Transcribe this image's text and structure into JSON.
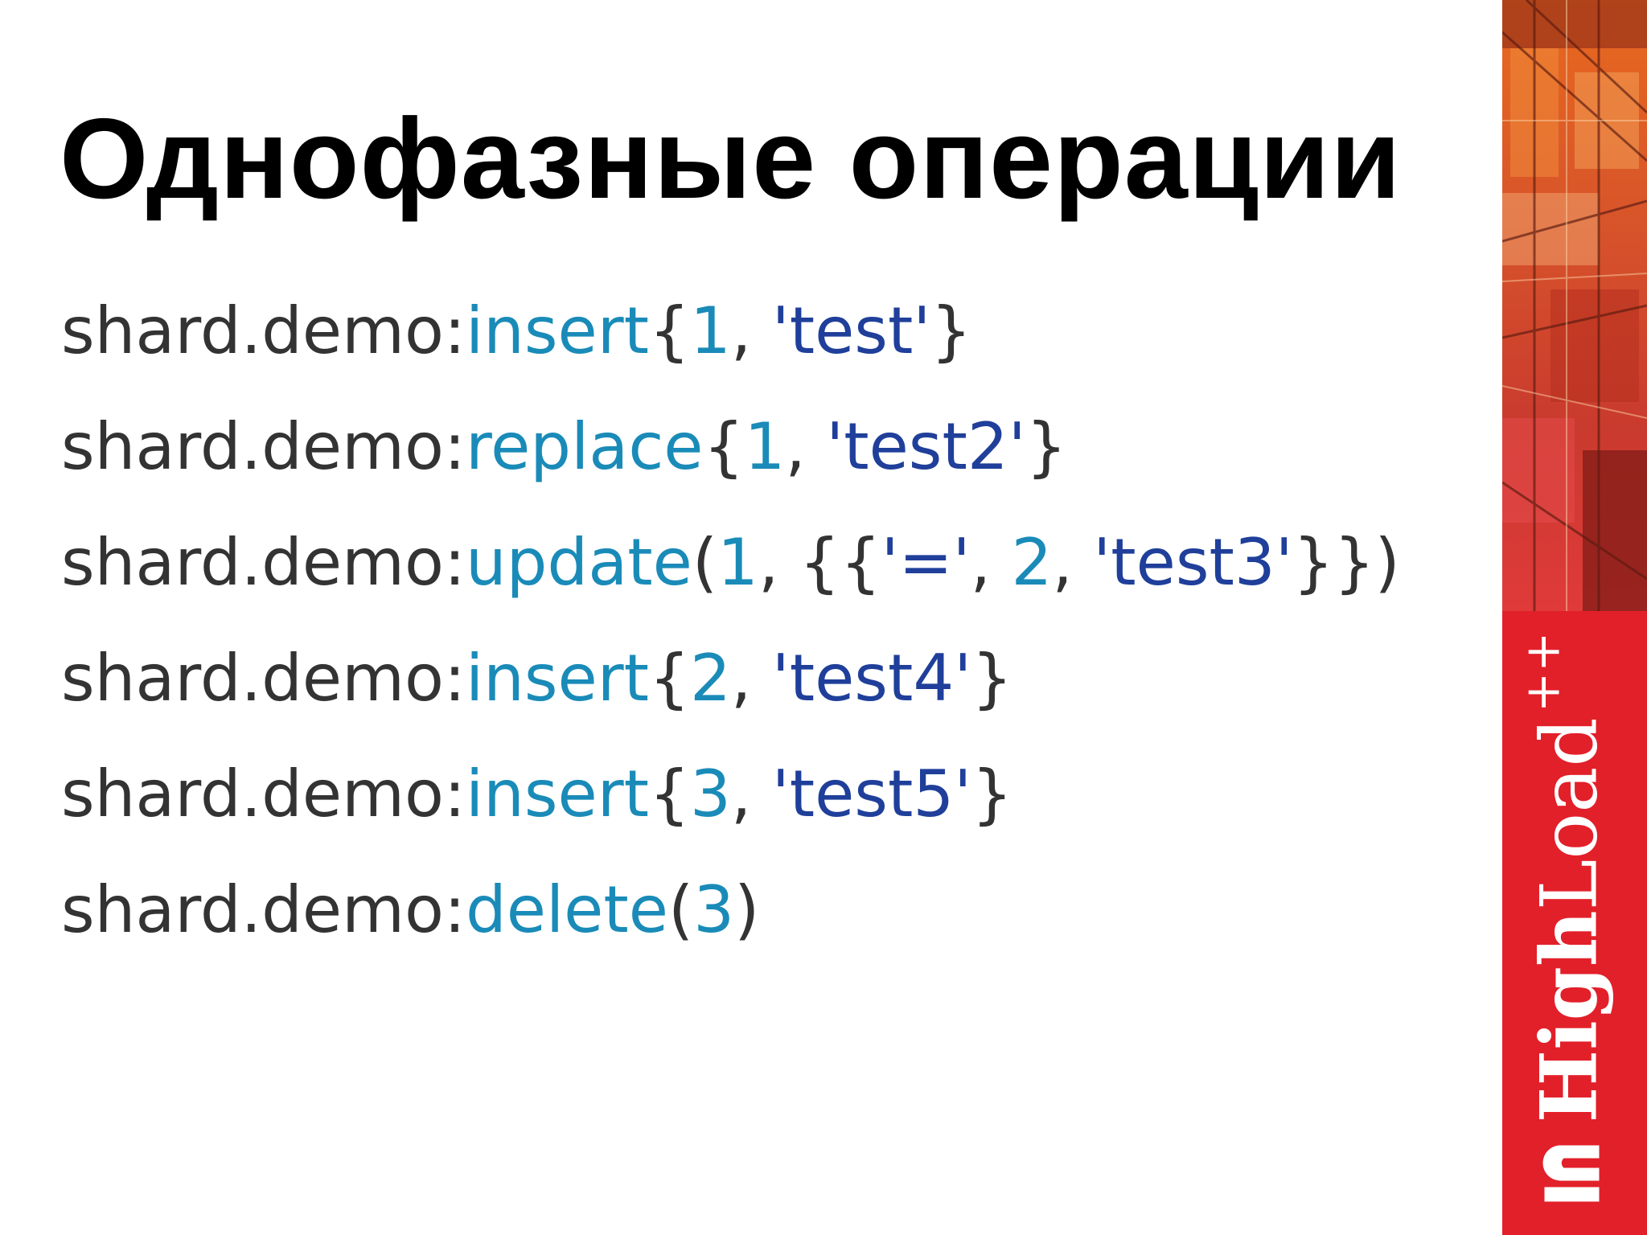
{
  "slide": {
    "title": "Однофазные операции",
    "code_lines": [
      [
        {
          "t": "shard.demo:",
          "c": "obj"
        },
        {
          "t": "insert",
          "c": "method"
        },
        {
          "t": "{",
          "c": "punct"
        },
        {
          "t": "1",
          "c": "num"
        },
        {
          "t": ", ",
          "c": "punct"
        },
        {
          "t": "'test'",
          "c": "str"
        },
        {
          "t": "}",
          "c": "punct"
        }
      ],
      [
        {
          "t": "shard.demo:",
          "c": "obj"
        },
        {
          "t": "replace",
          "c": "method"
        },
        {
          "t": "{",
          "c": "punct"
        },
        {
          "t": "1",
          "c": "num"
        },
        {
          "t": ", ",
          "c": "punct"
        },
        {
          "t": "'test2'",
          "c": "str"
        },
        {
          "t": "}",
          "c": "punct"
        }
      ],
      [
        {
          "t": "shard.demo:",
          "c": "obj"
        },
        {
          "t": "update",
          "c": "method"
        },
        {
          "t": "(",
          "c": "punct"
        },
        {
          "t": "1",
          "c": "num"
        },
        {
          "t": ", {{",
          "c": "punct"
        },
        {
          "t": "'='",
          "c": "str"
        },
        {
          "t": ", ",
          "c": "punct"
        },
        {
          "t": "2",
          "c": "num"
        },
        {
          "t": ", ",
          "c": "punct"
        },
        {
          "t": "'test3'",
          "c": "str"
        },
        {
          "t": "}})",
          "c": "punct"
        }
      ],
      [
        {
          "t": "shard.demo:",
          "c": "obj"
        },
        {
          "t": "insert",
          "c": "method"
        },
        {
          "t": "{",
          "c": "punct"
        },
        {
          "t": "2",
          "c": "num"
        },
        {
          "t": ", ",
          "c": "punct"
        },
        {
          "t": "'test4'",
          "c": "str"
        },
        {
          "t": "}",
          "c": "punct"
        }
      ],
      [
        {
          "t": "shard.demo:",
          "c": "obj"
        },
        {
          "t": "insert",
          "c": "method"
        },
        {
          "t": "{",
          "c": "punct"
        },
        {
          "t": "3",
          "c": "num"
        },
        {
          "t": ", ",
          "c": "punct"
        },
        {
          "t": "'test5'",
          "c": "str"
        },
        {
          "t": "}",
          "c": "punct"
        }
      ],
      [
        {
          "t": "shard.demo:",
          "c": "obj"
        },
        {
          "t": "delete",
          "c": "method"
        },
        {
          "t": "(",
          "c": "punct"
        },
        {
          "t": "3",
          "c": "num"
        },
        {
          "t": ")",
          "c": "punct"
        }
      ]
    ]
  },
  "branding": {
    "logo_high": "High",
    "logo_load": "Load",
    "logo_plus": "++",
    "logo_mark_icon": "highload-logo-mark-icon",
    "brand_color": "#e2202a"
  },
  "colors": {
    "method": "#1a8bb8",
    "number": "#1a8bb8",
    "string": "#1f3f9a",
    "text": "#333333",
    "title": "#000000"
  }
}
